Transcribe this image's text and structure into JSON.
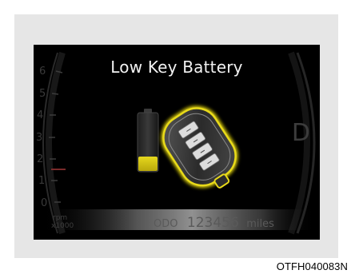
{
  "cluster": {
    "title": "Low Key Battery",
    "rpm_ticks": [
      "6",
      "5",
      "4",
      "3",
      "2",
      "1",
      "0"
    ],
    "rpm_label": "rpm",
    "rpm_unit": "x1000",
    "gear": "D",
    "odo": {
      "label": "ODO",
      "value": "123456",
      "unit": "miles"
    }
  },
  "caption": "OTFH040083N",
  "colors": {
    "battery_level": "#d4c410",
    "key_highlight": "#e8da1a"
  },
  "icons": [
    "battery-icon",
    "smart-key-icon"
  ]
}
